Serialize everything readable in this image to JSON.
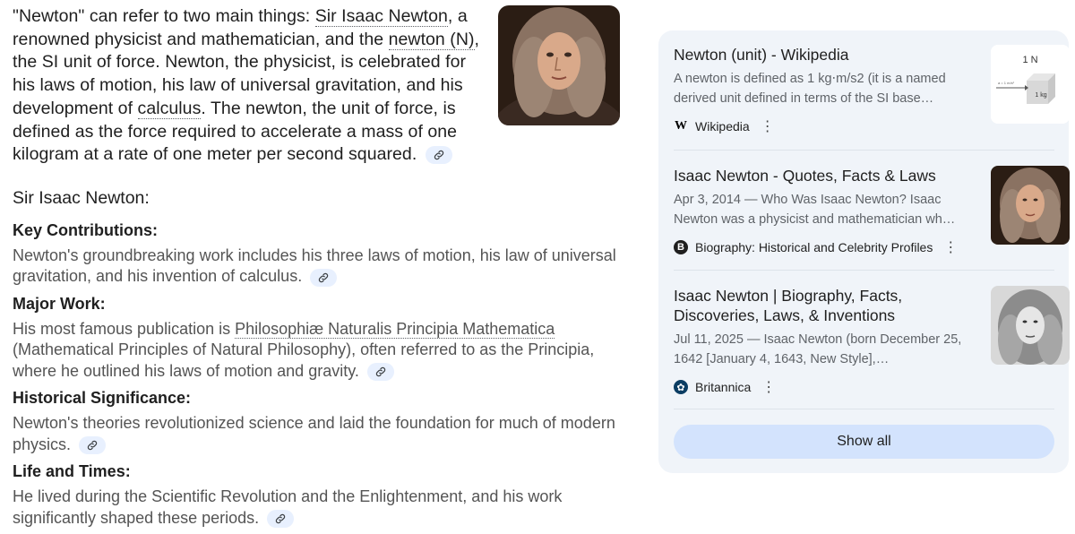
{
  "intro": {
    "p1": "\"Newton\" can refer to two main things: ",
    "link1": "Sir Isaac Newton",
    "p2": ", a renowned physicist and mathematician, and the ",
    "link2": "newton (N)",
    "p3": ", the SI unit of force. Newton, the physicist, is celebrated for his laws of motion, his law of universal gravitation, and his de­velopment of ",
    "link3": "calculus",
    "p4": ". The newton, the unit of force, is de­fined as the force required to accelerate a mass of one kilo­gram at a rate of one meter per second squared."
  },
  "main_heading": "Sir Isaac Newton:",
  "sections": [
    {
      "title": "Key Contributions:",
      "body": "Newton's groundbreaking work includes his three laws of motion, his law of universal gravitation, and his invention of calculus."
    },
    {
      "title": "Major Work:",
      "link": "Philosophiæ Naturalis Principia Mathematica",
      "body_pre": "His most famous publication is ",
      "body": " (Mathematical Principles of Natural Philosophy), often referred to as the Principia, where he outlined his laws of motion and gravity."
    },
    {
      "title": "Historical Significance:",
      "body": "Newton's theories revolutionized science and laid the foundation for much of modern physics."
    },
    {
      "title": "Life and Times:",
      "body": "He lived during the Scientific Revolution and the Enlightenment, and his work significantly shaped these periods."
    }
  ],
  "sources": [
    {
      "title": "Newton (unit) - Wikipedia",
      "snippet": "A newton is defined as 1 kg⋅m/s2 (it is a named derived unit defined in terms of the SI base…",
      "site": "Wikipedia",
      "favicon": "W",
      "thumb_label": "1 N",
      "thumb_sub": "1 kg",
      "thumb_arrow": "a = 1 m/s²"
    },
    {
      "title": "Isaac Newton - Quotes, Facts & Laws",
      "snippet": "Apr 3, 2014 — Who Was Isaac Newton? Isaac Newton was a physicist and mathematician wh…",
      "site": "Biography: Historical and Celebrity Profiles",
      "favicon": "B"
    },
    {
      "title": "Isaac Newton | Biography, Facts, Discoveries, Laws, & Inventions",
      "snippet": "Jul 11, 2025 — Isaac Newton (born December 25, 1642 [January 4, 1643, New Style],…",
      "site": "Britannica",
      "favicon": "✿"
    }
  ],
  "show_all": "Show all",
  "icons": {
    "link": "link-icon",
    "more": "more-vert-icon"
  },
  "colors": {
    "chip": "#e8f0fe",
    "panel": "#f0f4f9",
    "button": "#d3e3fd"
  }
}
